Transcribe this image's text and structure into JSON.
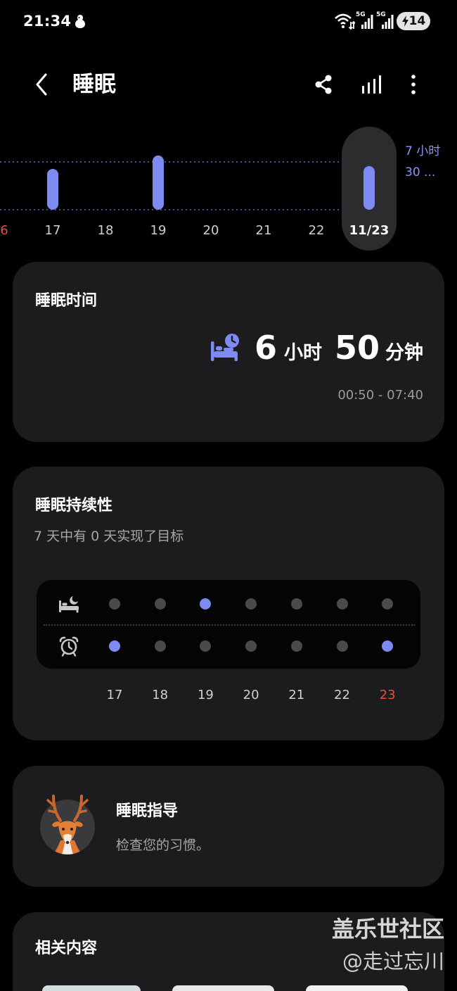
{
  "status_bar": {
    "time": "21:34",
    "network_1": "5G",
    "network_2": "5G",
    "battery": "14",
    "icons": [
      "notification-icon",
      "wifi-icon",
      "signal-icon",
      "signal-icon",
      "battery-charging-icon"
    ]
  },
  "header": {
    "title": "睡眠",
    "icons": [
      "back-icon",
      "share-icon",
      "trends-icon",
      "more-icon"
    ]
  },
  "chart_data": {
    "type": "bar",
    "categories": [
      "6",
      "17",
      "18",
      "19",
      "20",
      "21",
      "22",
      "11/23"
    ],
    "values": [
      null,
      6.4,
      null,
      8.5,
      null,
      null,
      null,
      6.83
    ],
    "category_colors": [
      "#e2503e",
      "#cfcfcf",
      "#cfcfcf",
      "#cfcfcf",
      "#cfcfcf",
      "#cfcfcf",
      "#cfcfcf",
      "#ffffff"
    ],
    "selected": "11/23",
    "goal": 7.5,
    "goal_label_line1": "7 小时",
    "goal_label_line2": "30 ..."
  },
  "sleep_time": {
    "title": "睡眠时间",
    "hours": "6",
    "hours_unit": "小时",
    "minutes": "50",
    "minutes_unit": "分钟",
    "range": "00:50 - 07:40",
    "icon": "bed-clock-icon"
  },
  "sleep_consistency": {
    "title": "睡眠持续性",
    "summary": "7 天中有 0 天实现了目标",
    "days": [
      "17",
      "18",
      "19",
      "20",
      "21",
      "22",
      "23"
    ],
    "day_colors": [
      "#cfcfcf",
      "#cfcfcf",
      "#cfcfcf",
      "#cfcfcf",
      "#cfcfcf",
      "#cfcfcf",
      "#e2503e"
    ],
    "bedtime_marks": [
      false,
      false,
      true,
      false,
      false,
      false,
      false
    ],
    "wake_marks": [
      true,
      false,
      false,
      false,
      false,
      false,
      true
    ],
    "icons": [
      "bed-moon-icon",
      "alarm-clock-icon"
    ]
  },
  "sleep_coaching": {
    "title": "睡眠指导",
    "subtitle": "检查您的习惯。",
    "icon": "deer-avatar-icon"
  },
  "related": {
    "title": "相关内容"
  },
  "watermark": {
    "line1": "盖乐世社区",
    "line2": "@走过忘川"
  },
  "colors": {
    "background": "#000000",
    "card": "#1c1c1e",
    "accent": "#7d8af2",
    "alert": "#e2503e",
    "muted_dot": "#4a4a4c",
    "chart_grid": "#5d66ad",
    "selection": "#2c2c2e"
  }
}
